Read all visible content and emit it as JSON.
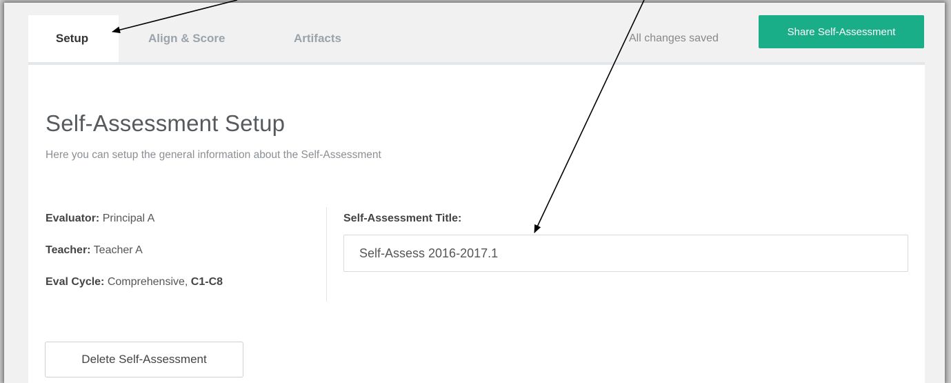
{
  "tabs": {
    "setup": "Setup",
    "align_score": "Align & Score",
    "artifacts": "Artifacts"
  },
  "header": {
    "save_status": "All changes saved",
    "share_label": "Share Self-Assessment"
  },
  "setup": {
    "title": "Self-Assessment Setup",
    "subtitle": "Here you can setup the general information about the Self-Assessment",
    "evaluator_label": "Evaluator:",
    "evaluator_value": "Principal A",
    "teacher_label": "Teacher:",
    "teacher_value": "Teacher A",
    "eval_cycle_label": "Eval Cycle:",
    "eval_cycle_value": "Comprehensive,",
    "eval_cycle_range": "C1-C8",
    "sa_title_label": "Self-Assessment Title:",
    "sa_title_value": "Self-Assess 2016-2017.1",
    "delete_label": "Delete Self-Assessment"
  },
  "colors": {
    "accent": "#1aae88",
    "annotation_arrow": "#000000"
  }
}
